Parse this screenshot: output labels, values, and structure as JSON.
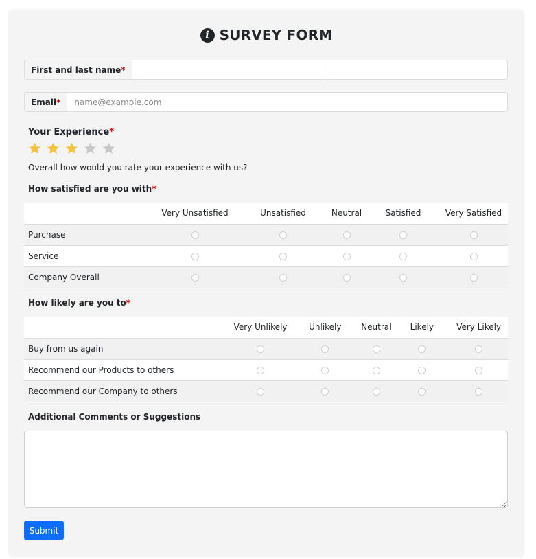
{
  "form": {
    "title": "SURVEY FORM",
    "title_icon": "info-circle-icon",
    "name_label": "First and last name",
    "email_label": "Email",
    "email_placeholder": "name@example.com",
    "required_mark": "*",
    "experience_label": "Your Experience",
    "rating": {
      "value": 3,
      "max": 5,
      "filled_color": "#f5c342",
      "empty_color": "#c8c8c8"
    },
    "experience_help": "Overall how would you rate your experience with us?",
    "satisfied_label": "How satisfied are you with",
    "satisfied_columns": [
      "Very Unsatisfied",
      "Unsatisfied",
      "Neutral",
      "Satisfied",
      "Very Satisfied"
    ],
    "satisfied_rows": [
      "Purchase",
      "Service",
      "Company Overall"
    ],
    "likely_label": "How likely are you to",
    "likely_columns": [
      "Very Unlikely",
      "Unlikely",
      "Neutral",
      "Likely",
      "Very Likely"
    ],
    "likely_rows": [
      "Buy from us again",
      "Recommend our Products to others",
      "Recommend our Company to others"
    ],
    "comments_label": "Additional Comments or Suggestions",
    "submit_label": "Submit",
    "accent_color": "#0d6efd",
    "required_color": "#cc0000"
  }
}
